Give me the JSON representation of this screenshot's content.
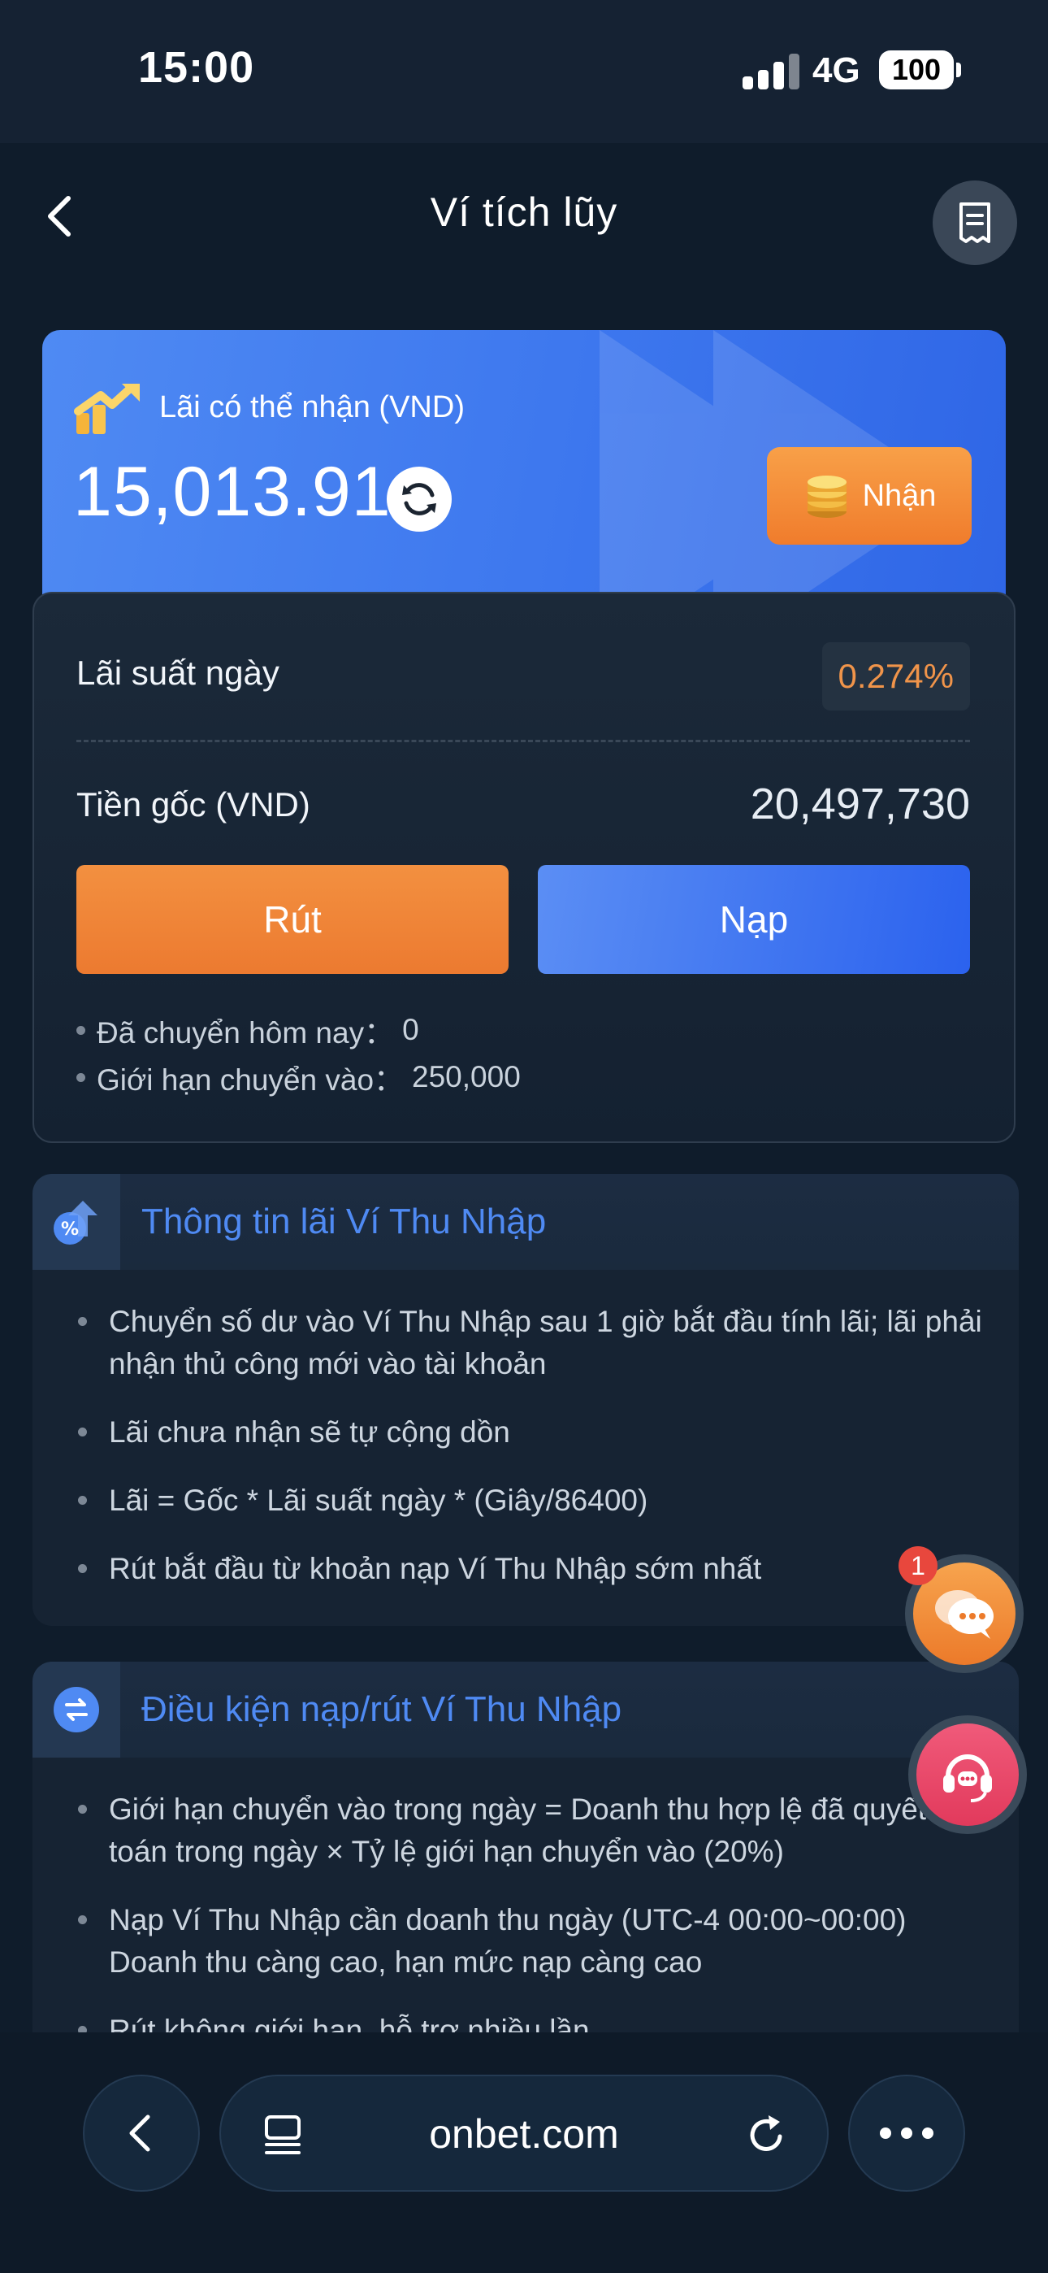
{
  "status_bar": {
    "time": "15:00",
    "network": "4G",
    "battery": "100",
    "icons": [
      "signal-icon",
      "battery-icon"
    ]
  },
  "header": {
    "title": "Ví tích lũy",
    "icons": [
      "back-arrow-icon",
      "records-icon"
    ]
  },
  "interest_card": {
    "label": "Lãi có thể nhận (VND)",
    "amount": "15,013.91",
    "claim_label": "Nhận",
    "icons": [
      "trend-up-icon",
      "refresh-icon",
      "coins-icon"
    ]
  },
  "wallet": {
    "daily_rate_label": "Lãi suất ngày",
    "daily_rate_value": "0.274%",
    "principal_label": "Tiền gốc (VND)",
    "principal_value": "20,497,730",
    "withdraw_label": "Rút",
    "deposit_label": "Nạp",
    "notes": [
      {
        "label": "Đã chuyển hôm nay：",
        "value": "0"
      },
      {
        "label": "Giới hạn chuyển vào：",
        "value": "250,000"
      }
    ]
  },
  "sections": [
    {
      "title": "Thông tin lãi Ví Thu Nhập",
      "icon": "percent-icon",
      "items": [
        "Chuyển số dư vào Ví Thu Nhập sau 1 giờ bắt đầu tính lãi; lãi phải nhận thủ công mới vào tài khoản",
        "Lãi chưa nhận sẽ tự cộng dồn",
        "Lãi = Gốc * Lãi suất ngày * (Giây/86400)",
        "Rút bắt đầu từ khoản nạp Ví Thu Nhập sớm nhất"
      ]
    },
    {
      "title": "Điều kiện nạp/rút Ví Thu Nhập",
      "icon": "exchange-icon",
      "items": [
        "Giới hạn chuyển vào trong ngày = Doanh thu hợp lệ đã quyết toán trong ngày × Tỷ lệ giới hạn chuyển vào (20%)",
        "Nạp Ví Thu Nhập cần doanh thu ngày (UTC-4 00:00~00:00) Doanh thu càng cao, hạn mức nạp càng cao",
        "Rút không giới hạn, hỗ trợ nhiều lần"
      ]
    }
  ],
  "floating": {
    "chat_badge": "1",
    "icons": [
      "chat-bubble-icon",
      "headset-support-icon"
    ]
  },
  "browser_bar": {
    "domain": "onbet.com",
    "icons": [
      "browser-back-icon",
      "tabs-icon",
      "reload-icon",
      "more-icon"
    ]
  },
  "colors": {
    "background": "#0f1c2b",
    "accent_blue": "#3d77ee",
    "accent_orange": "#ef8534",
    "rate_orange": "#f0944a",
    "section_title_blue": "#4f8af3"
  }
}
